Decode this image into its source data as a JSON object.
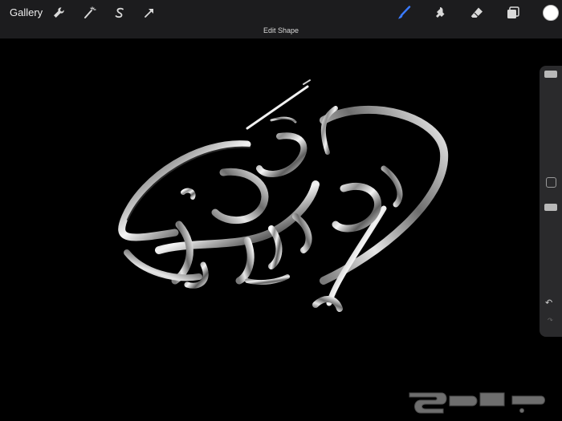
{
  "toolbar": {
    "gallery_label": "Gallery",
    "left_tools": [
      {
        "name": "actions",
        "icon": "wrench-icon"
      },
      {
        "name": "adjustments",
        "icon": "magic-wand-icon"
      },
      {
        "name": "selection",
        "icon": "selection-s-icon"
      },
      {
        "name": "transform",
        "icon": "arrow-cursor-icon"
      }
    ],
    "right_tools": [
      {
        "name": "brush",
        "icon": "brush-icon",
        "active": true
      },
      {
        "name": "smudge",
        "icon": "smudge-icon"
      },
      {
        "name": "eraser",
        "icon": "eraser-icon"
      },
      {
        "name": "layers",
        "icon": "layers-icon"
      }
    ],
    "current_color": "#ffffff",
    "accent_color": "#3a7bff"
  },
  "shape_bar": {
    "label": "Edit Shape"
  },
  "sidebar": {
    "brush_size_level": 1.0,
    "opacity_level": 1.0,
    "undo_symbol": "↶",
    "redo_symbol": "↷"
  },
  "canvas": {
    "background": "#000000"
  },
  "watermark": {
    "text": "حراج",
    "logo": "haraj-logo"
  }
}
